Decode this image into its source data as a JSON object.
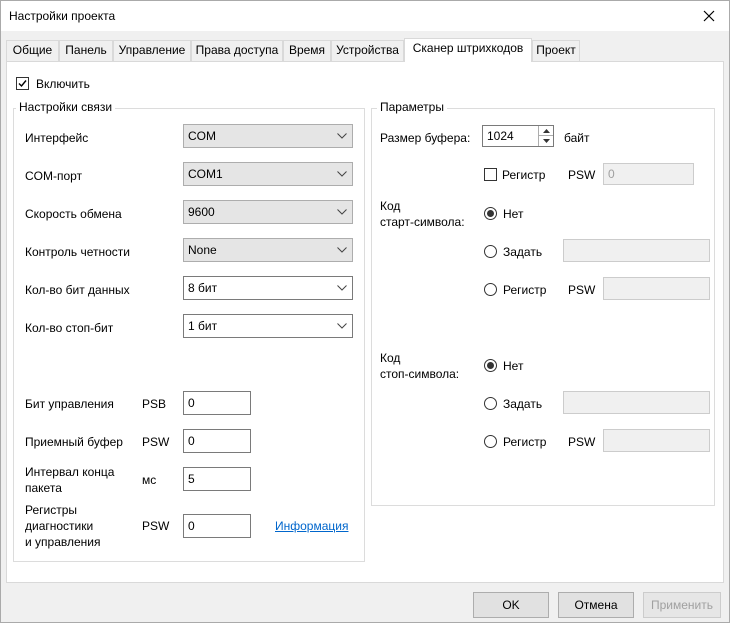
{
  "window": {
    "title": "Настройки проекта"
  },
  "tabs": [
    {
      "label": "Общие"
    },
    {
      "label": "Панель"
    },
    {
      "label": "Управление"
    },
    {
      "label": "Права доступа"
    },
    {
      "label": "Время"
    },
    {
      "label": "Устройства"
    },
    {
      "label": "Сканер штрихкодов"
    },
    {
      "label": "Проект"
    }
  ],
  "enable": {
    "label": "Включить",
    "checked": true
  },
  "comm": {
    "title": "Настройки связи",
    "interface": {
      "label": "Интерфейс",
      "value": "COM"
    },
    "com_port": {
      "label": "COM-порт",
      "value": "COM1"
    },
    "baud": {
      "label": "Скорость обмена",
      "value": "9600"
    },
    "parity": {
      "label": "Контроль четности",
      "value": "None"
    },
    "data_bits": {
      "label": "Кол-во бит данных",
      "value": "8 бит"
    },
    "stop_bits": {
      "label": "Кол-во стоп-бит",
      "value": "1 бит"
    },
    "control_bit": {
      "label": "Бит управления",
      "unit": "PSB",
      "value": "0"
    },
    "recv_buffer": {
      "label": "Приемный буфер",
      "unit": "PSW",
      "value": "0"
    },
    "packet_interval": {
      "label_line1": "Интервал конца",
      "label_line2": "пакета",
      "unit": "мс",
      "value": "5"
    },
    "diag": {
      "label_line1": "Регистры",
      "label_line2": "диагностики",
      "label_line3": "и управления",
      "unit": "PSW",
      "value": "0",
      "link": "Информация"
    }
  },
  "params": {
    "title": "Параметры",
    "buffer_size": {
      "label": "Размер буфера:",
      "value": "1024",
      "unit": "байт"
    },
    "register": {
      "label": "Регистр",
      "unit": "PSW",
      "value": "0"
    },
    "start_code": {
      "label_line1": "Код",
      "label_line2": "старт-символа:",
      "none_label": "Нет",
      "set_label": "Задать",
      "register_label": "Регистр",
      "register_unit": "PSW"
    },
    "stop_code": {
      "label_line1": "Код",
      "label_line2": "стоп-символа:",
      "none_label": "Нет",
      "set_label": "Задать",
      "register_label": "Регистр",
      "register_unit": "PSW"
    }
  },
  "buttons": {
    "ok": "OK",
    "cancel": "Отмена",
    "apply": "Применить"
  }
}
